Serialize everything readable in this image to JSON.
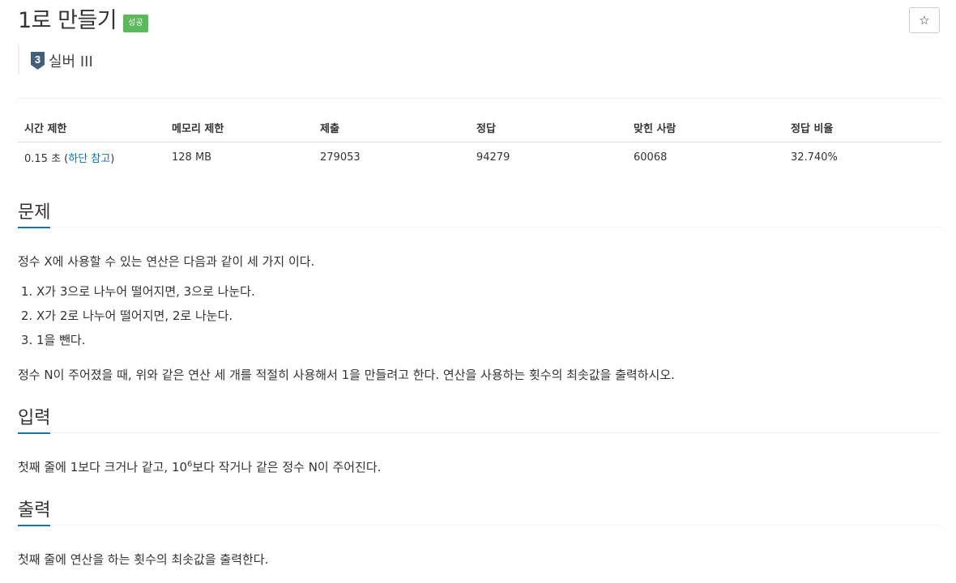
{
  "header": {
    "title": "1로 만들기",
    "badge": "성공",
    "star_icon": "☆",
    "tier": {
      "icon_digit": "3",
      "label": "실버 III"
    }
  },
  "info_table": {
    "headers": [
      "시간 제한",
      "메모리 제한",
      "제출",
      "정답",
      "맞힌 사람",
      "정답 비율"
    ],
    "time_limit": "0.15 초 (",
    "time_limit_link": "하단 참고",
    "time_limit_close": ")",
    "memory": "128 MB",
    "submissions": "279053",
    "accepted": "94279",
    "solvers": "60068",
    "ratio": "32.740%"
  },
  "problem": {
    "heading": "문제",
    "intro": "정수 X에 사용할 수 있는 연산은 다음과 같이 세 가지 이다.",
    "steps": [
      "X가 3으로 나누어 떨어지면, 3으로 나눈다.",
      "X가 2로 나누어 떨어지면, 2로 나눈다.",
      "1을 뺀다."
    ],
    "body": "정수 N이 주어졌을 때, 위와 같은 연산 세 개를 적절히 사용해서 1을 만들려고 한다. 연산을 사용하는 횟수의 최솟값을 출력하시오."
  },
  "input": {
    "heading": "입력",
    "text_before": "첫째 줄에 1보다 크거나 같고, 10",
    "sup": "6",
    "text_after": "보다 작거나 같은 정수 N이 주어진다."
  },
  "output": {
    "heading": "출력",
    "text": "첫째 줄에 연산을 하는 횟수의 최솟값을 출력한다."
  },
  "colors": {
    "badge": "#5cb85c",
    "link": "#0076c0",
    "accent": "#0e77b6"
  }
}
